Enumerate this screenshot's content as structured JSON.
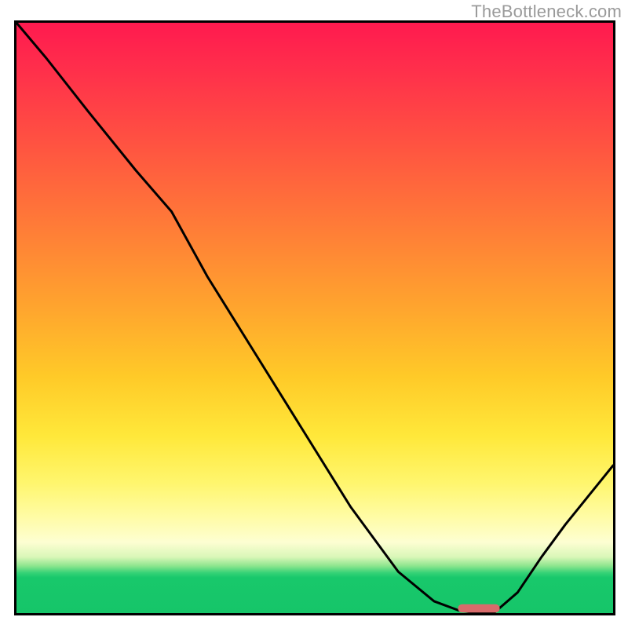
{
  "watermark": "TheBottleneck.com",
  "colors": {
    "frame": "#000000",
    "curve": "#000000",
    "marker": "#d86b6b",
    "gradient_top": "#ff1a4f",
    "gradient_mid": "#ffe83a",
    "gradient_bottom": "#16c569"
  },
  "chart_data": {
    "type": "line",
    "title": "",
    "xlabel": "",
    "ylabel": "",
    "xlim": [
      0,
      100
    ],
    "ylim": [
      0,
      100
    ],
    "grid": false,
    "series": [
      {
        "name": "bottleneck-curve",
        "x": [
          0,
          5,
          12,
          20,
          26,
          32,
          40,
          48,
          56,
          64,
          70,
          74,
          77,
          80,
          84,
          88,
          92,
          96,
          100
        ],
        "y": [
          100,
          94,
          85,
          75,
          68,
          57,
          44,
          31,
          18,
          7,
          2,
          0.5,
          0,
          0,
          3.5,
          9.5,
          15,
          20,
          25
        ]
      }
    ],
    "marker": {
      "name": "optimal-range",
      "x_start": 74,
      "x_end": 81,
      "y": 0.8
    },
    "legend": false
  }
}
